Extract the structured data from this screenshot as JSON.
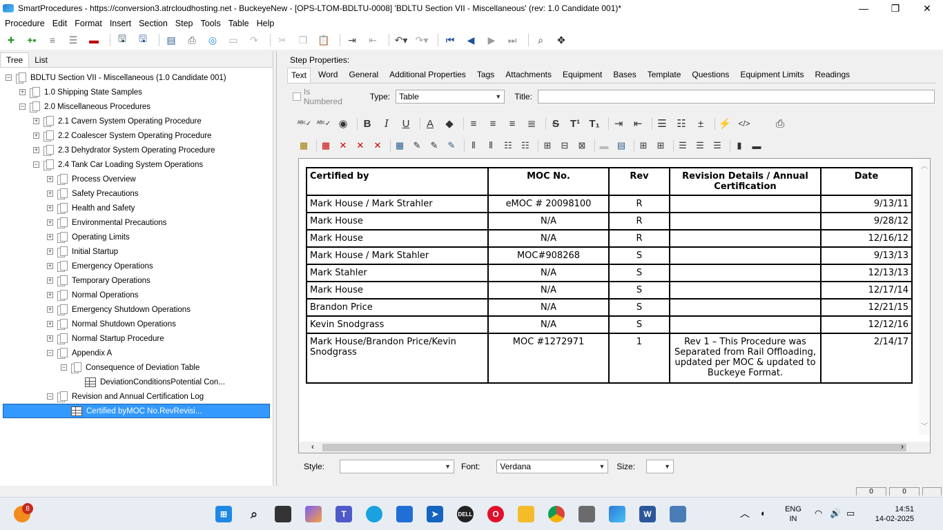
{
  "window": {
    "title": "SmartProcedures - https://conversion3.atrcloudhosting.net - BuckeyeNew - [OPS-LTOM-BDLTU-0008] 'BDLTU Section VII - Miscellaneous' (rev: 1.0 Candidate 001)*"
  },
  "menu": [
    "Procedure",
    "Edit",
    "Format",
    "Insert",
    "Section",
    "Step",
    "Tools",
    "Table",
    "Help"
  ],
  "left_tabs": [
    "Tree",
    "List"
  ],
  "tree": [
    {
      "label": "BDLTU Section VII - Miscellaneous (1.0 Candidate 001)",
      "level": 0,
      "exp": "−",
      "icon": "doc"
    },
    {
      "label": "1.0 Shipping State Samples",
      "level": 1,
      "exp": "+",
      "icon": "doc"
    },
    {
      "label": "2.0 Miscellaneous Procedures",
      "level": 1,
      "exp": "−",
      "icon": "doc"
    },
    {
      "label": "2.1 Cavern System Operating Procedure",
      "level": 2,
      "exp": "+",
      "icon": "doc"
    },
    {
      "label": "2.2 Coalescer System Operating Procedure",
      "level": 2,
      "exp": "+",
      "icon": "doc"
    },
    {
      "label": "2.3 Dehydrator System Operating Procedure",
      "level": 2,
      "exp": "+",
      "icon": "doc"
    },
    {
      "label": "2.4 Tank Car Loading System Operations",
      "level": 2,
      "exp": "−",
      "icon": "doc"
    },
    {
      "label": "Process Overview",
      "level": 3,
      "exp": "+",
      "icon": "doc"
    },
    {
      "label": "Safety Precautions",
      "level": 3,
      "exp": "+",
      "icon": "doc"
    },
    {
      "label": "Health and Safety",
      "level": 3,
      "exp": "+",
      "icon": "doc"
    },
    {
      "label": "Environmental Precautions",
      "level": 3,
      "exp": "+",
      "icon": "doc"
    },
    {
      "label": "Operating Limits",
      "level": 3,
      "exp": "+",
      "icon": "doc"
    },
    {
      "label": "Initial Startup",
      "level": 3,
      "exp": "+",
      "icon": "doc"
    },
    {
      "label": "Emergency Operations",
      "level": 3,
      "exp": "+",
      "icon": "doc"
    },
    {
      "label": "Temporary Operations",
      "level": 3,
      "exp": "+",
      "icon": "doc"
    },
    {
      "label": "Normal Operations",
      "level": 3,
      "exp": "+",
      "icon": "doc"
    },
    {
      "label": "Emergency Shutdown Operations",
      "level": 3,
      "exp": "+",
      "icon": "doc"
    },
    {
      "label": "Normal Shutdown Operations",
      "level": 3,
      "exp": "+",
      "icon": "doc"
    },
    {
      "label": "Normal Startup Procedure",
      "level": 3,
      "exp": "+",
      "icon": "doc"
    },
    {
      "label": "Appendix A",
      "level": 3,
      "exp": "−",
      "icon": "doc"
    },
    {
      "label": "Consequence of Deviation Table",
      "level": 4,
      "exp": "−",
      "icon": "doc"
    },
    {
      "label": "DeviationConditionsPotential Con...",
      "level": 5,
      "exp": "",
      "icon": "table"
    },
    {
      "label": "Revision and Annual Certification Log",
      "level": 3,
      "exp": "−",
      "icon": "doc"
    },
    {
      "label": "Certified byMOC No.RevRevisi...",
      "level": 4,
      "exp": "",
      "icon": "table",
      "selected": true
    }
  ],
  "step_properties_label": "Step Properties:",
  "right_tabs": [
    "Text",
    "Word",
    "General",
    "Additional Properties",
    "Tags",
    "Attachments",
    "Equipment",
    "Bases",
    "Template",
    "Questions",
    "Equipment Limits",
    "Readings"
  ],
  "type_bar": {
    "is_numbered": "Is Numbered",
    "type_label": "Type:",
    "type_value": "Table",
    "title_label": "Title:",
    "title_value": ""
  },
  "table": {
    "headers": [
      "Certified by",
      "MOC No.",
      "Rev",
      "Revision Details / Annual Certification",
      "Date"
    ],
    "rows": [
      [
        "Mark House / Mark Strahler",
        "eMOC # 20098100",
        "R",
        "",
        "9/13/11"
      ],
      [
        "Mark House",
        "N/A",
        "R",
        "",
        "9/28/12"
      ],
      [
        "Mark House",
        "N/A",
        "R",
        "",
        "12/16/12"
      ],
      [
        "Mark House / Mark Stahler",
        "MOC#908268",
        "S",
        "",
        "9/13/13"
      ],
      [
        "Mark Stahler",
        "N/A",
        "S",
        "",
        "12/13/13"
      ],
      [
        "Mark House",
        "N/A",
        "S",
        "",
        "12/17/14"
      ],
      [
        "Brandon Price",
        "N/A",
        "S",
        "",
        "12/21/15"
      ],
      [
        "Kevin Snodgrass",
        "N/A",
        "S",
        "",
        "12/12/16"
      ],
      [
        "Mark House/Brandon Price/Kevin Snodgrass",
        "MOC #1272971",
        "1",
        "Rev 1 – This Procedure was Separated from Rail Offloading, updated per MOC & updated to Buckeye Format.",
        "2/14/17"
      ]
    ]
  },
  "bottom_bar": {
    "style_label": "Style:",
    "style_value": "",
    "font_label": "Font:",
    "font_value": "Verdana",
    "size_label": "Size:",
    "size_value": ""
  },
  "status": {
    "box1": "0",
    "box2": "0"
  },
  "taskbar": {
    "notification_count": "8",
    "lang_top": "ENG",
    "lang_bottom": "IN",
    "time": "14:51",
    "date": "14-02-2025"
  }
}
